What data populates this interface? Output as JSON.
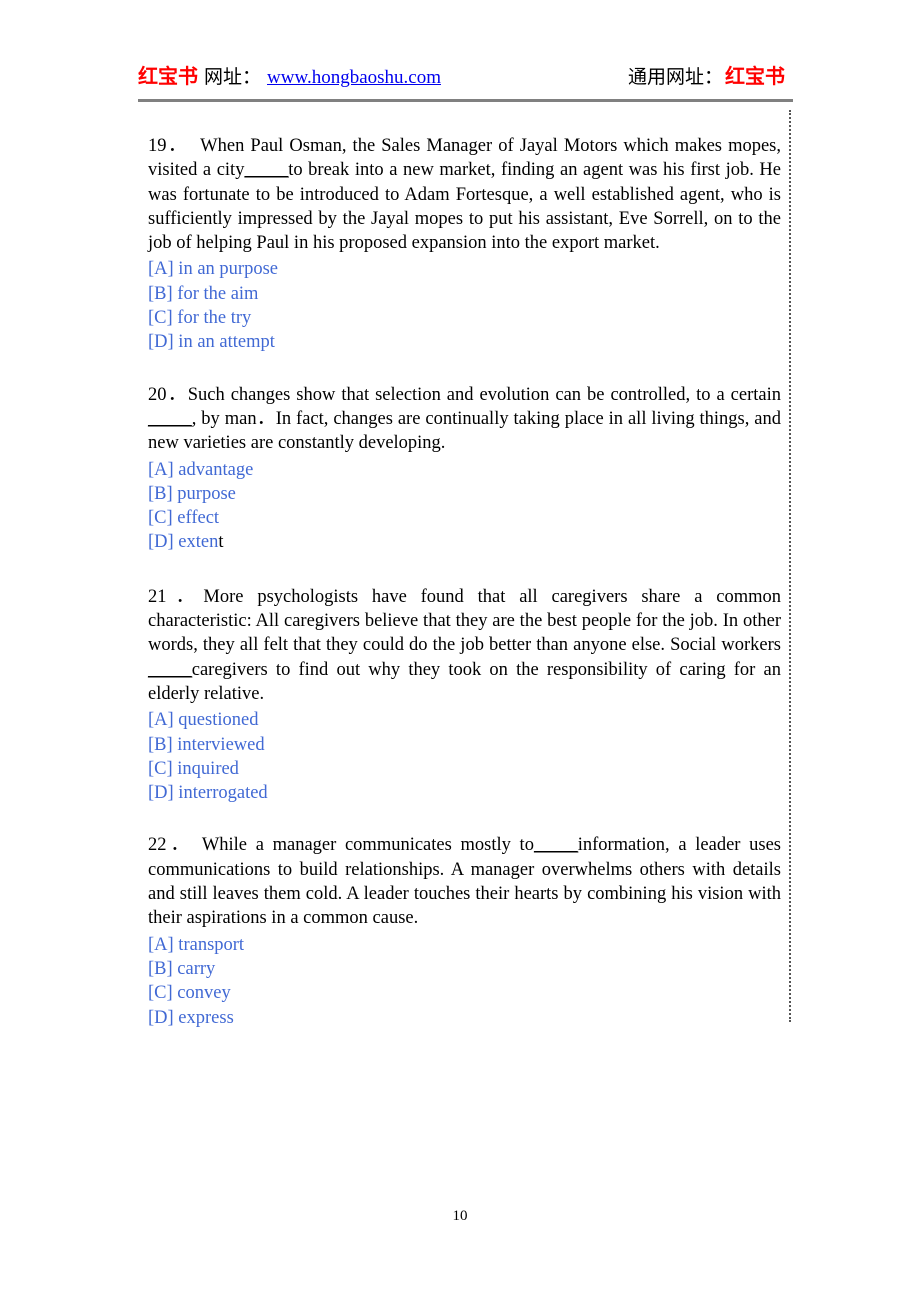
{
  "header": {
    "brand": "红宝书",
    "url_label": "网址：",
    "url": "www.hongbaoshu.com",
    "generic_label": "通用网址：",
    "generic_brand": "红宝书"
  },
  "questions": [
    {
      "number": "19．",
      "text_before": "When Paul Osman, the Sales Manager of Jayal Motors which makes mopes, visited a city",
      "blank": "_____",
      "text_after": "to break into a new market, finding an agent was his first job. He was fortunate to be introduced to Adam Fortesque, a well established agent, who is sufficiently impressed by the Jayal mopes to put his assistant, Eve Sorrell, on to the job of helping Paul in his proposed expansion into the export market.",
      "options": [
        "[A] in an purpose",
        "[B] for the aim",
        "[C] for the try",
        "[D] in an attempt"
      ]
    },
    {
      "number": "20．",
      "text_before": "Such changes show that selection and evolution can be controlled, to a certain ",
      "blank": "_____",
      "text_after": ", by man．In fact, changes are continually taking place in all living things, and new varieties are constantly developing.",
      "options": [
        "[A] advantage",
        "[B] purpose",
        "[C] effect",
        "[D] exten"
      ],
      "option_d_tail": "t"
    },
    {
      "number": "21．",
      "text_before": "More psychologists have found that all caregivers share a common characteristic: All caregivers believe that they are the best people for the job. In other words, they all felt that they could do the job better than anyone else. Social workers ",
      "blank": "_____",
      "text_after": "caregivers to find out why they took on the responsibility of caring for an elderly relative.",
      "options": [
        "[A] questioned",
        "[B] interviewed",
        "[C] inquired",
        "[D] interrogated"
      ]
    },
    {
      "number": "22．",
      "text_before": "While a manager communicates mostly to",
      "blank": "_____",
      "text_after": "information, a leader uses communications to build relationships. A manager overwhelms others with details and still leaves them cold. A leader touches their hearts by combining his vision with their aspirations in a common cause.",
      "options": [
        "[A] transport",
        "[B] carry",
        "[C] convey",
        "[D] express"
      ]
    }
  ],
  "footer": {
    "page_number": "10"
  }
}
